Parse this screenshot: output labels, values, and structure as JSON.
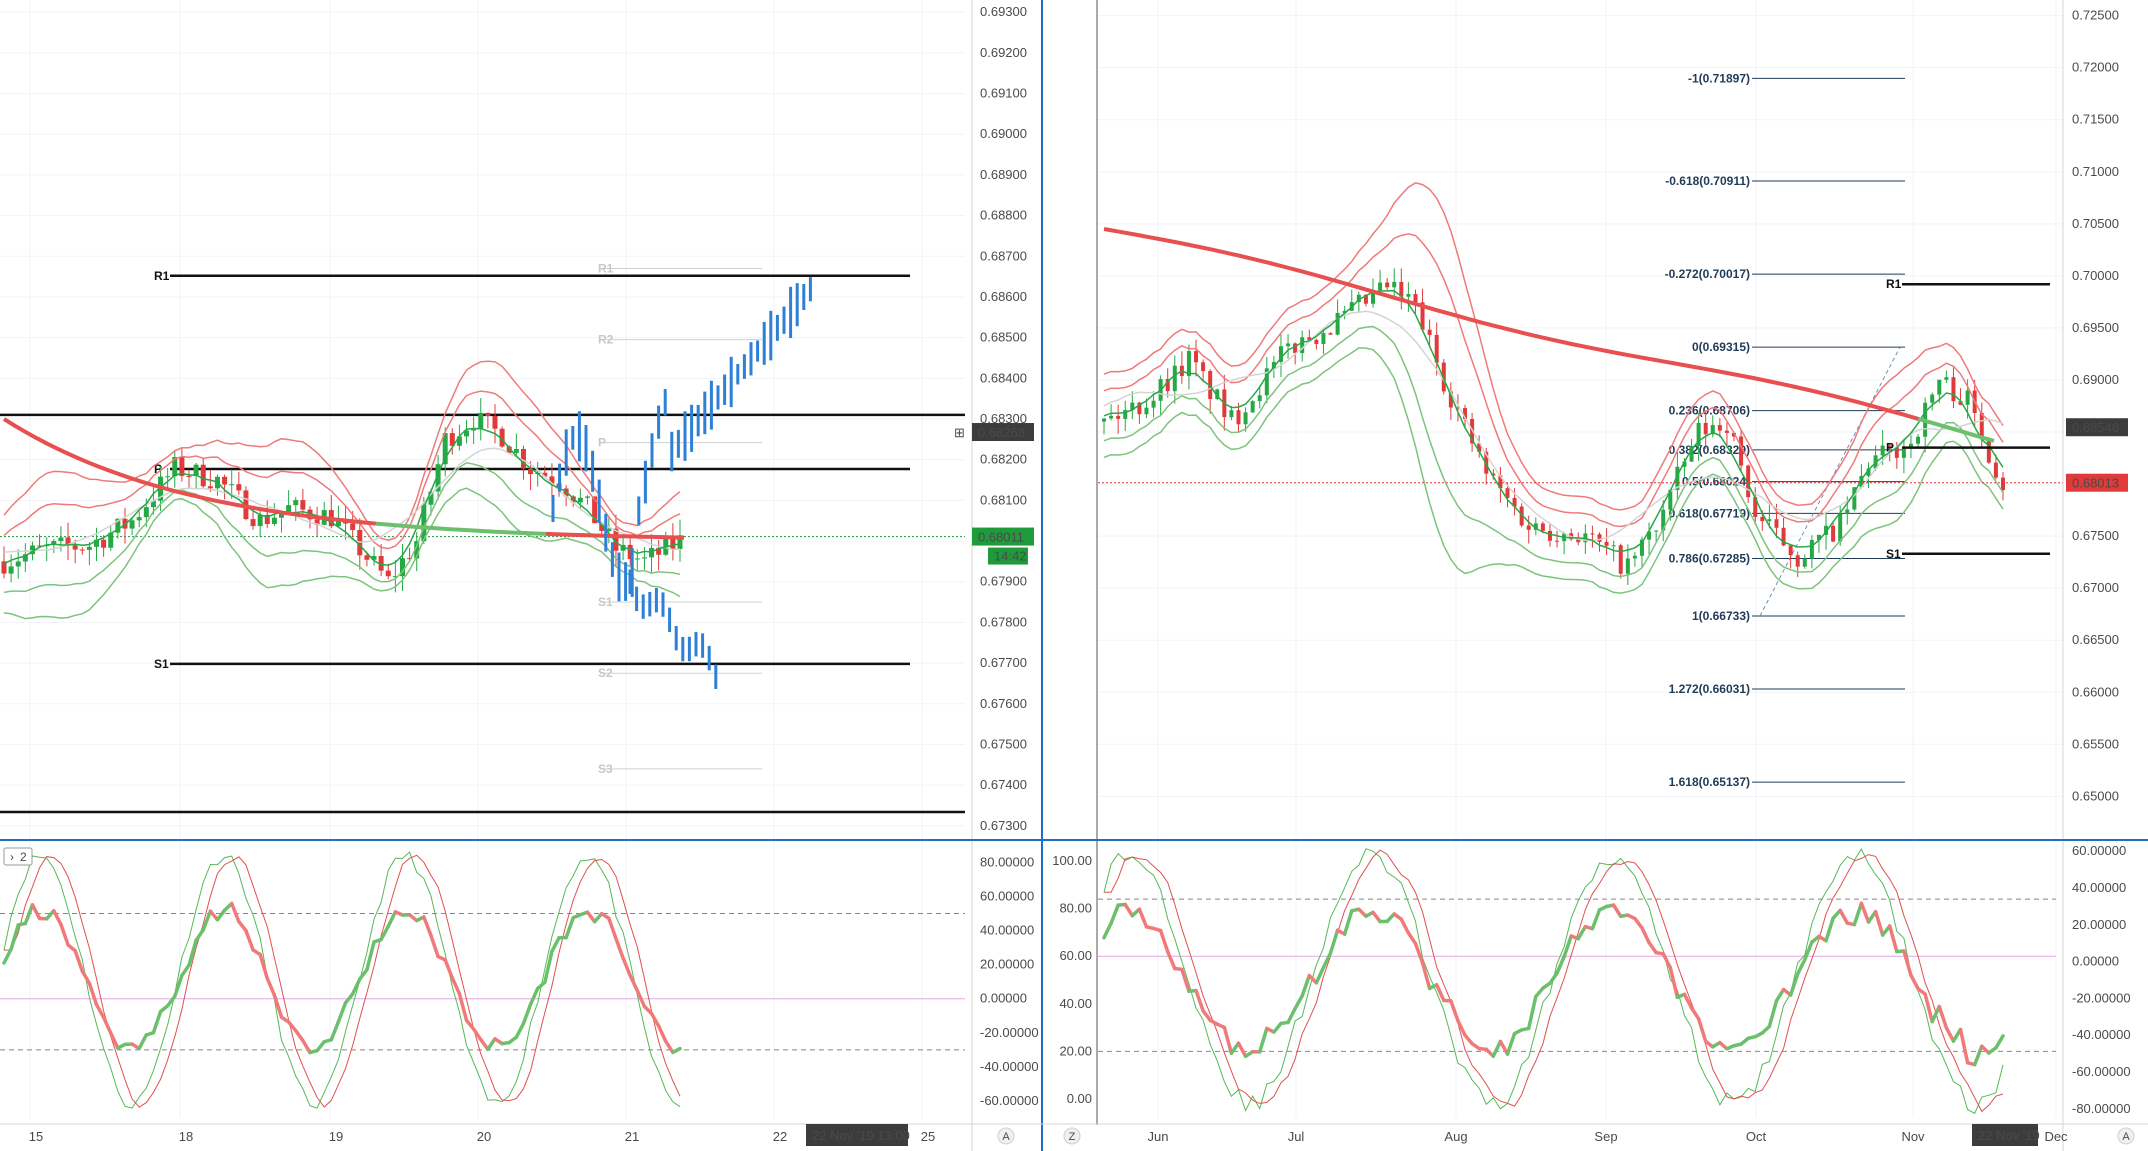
{
  "chart_data": [
    {
      "panel": "left-price",
      "type": "candlestick",
      "y_axis_ticks": [
        "0.69300",
        "0.69200",
        "0.69100",
        "0.69000",
        "0.68900",
        "0.68800",
        "0.68700",
        "0.68600",
        "0.68500",
        "0.68400",
        "0.68300",
        "0.68200",
        "0.68100",
        "0.68000",
        "0.67900",
        "0.67800",
        "0.67700",
        "0.67600",
        "0.67500",
        "0.67400",
        "0.67300"
      ],
      "ylim": [
        0.6727,
        0.6933
      ],
      "x_ticks": [
        "15",
        "18",
        "19",
        "20",
        "21",
        "22",
        "25"
      ],
      "price_badges": {
        "upper": "0.68268",
        "lower": "0.68011",
        "countdown": "14:42"
      },
      "levels": [
        {
          "label": "R1",
          "value": 0.68652
        },
        {
          "label": "P",
          "value": 0.68177
        },
        {
          "label": "S1",
          "value": 0.67698
        },
        {
          "label": "",
          "value": 0.6831
        },
        {
          "label": "",
          "value": 0.67334
        }
      ],
      "ghost_levels": [
        {
          "label": "R1",
          "value": 0.6867
        },
        {
          "label": "R2",
          "value": 0.68495
        },
        {
          "label": "P",
          "value": 0.68242
        },
        {
          "label": "S1",
          "value": 0.6785
        },
        {
          "label": "S2",
          "value": 0.67675
        },
        {
          "label": "S3",
          "value": 0.6744
        }
      ],
      "date_badge": "22 Nov '19  13:00"
    },
    {
      "panel": "right-price",
      "type": "candlestick",
      "y_axis_ticks": [
        "0.72500",
        "0.72000",
        "0.71500",
        "0.71000",
        "0.70500",
        "0.70000",
        "0.69500",
        "0.69000",
        "0.68500",
        "0.68000",
        "0.67500",
        "0.67000",
        "0.66500",
        "0.66000",
        "0.65500",
        "0.65000"
      ],
      "ylim": [
        0.646,
        0.7265
      ],
      "x_ticks": [
        "Jun",
        "Jul",
        "Aug",
        "Sep",
        "Oct",
        "Nov",
        "Dec"
      ],
      "price_badges": {
        "upper": "0.68546",
        "lower": "0.68013"
      },
      "levels": [
        {
          "label": "R1",
          "value": 0.6992
        },
        {
          "label": "P",
          "value": 0.6835
        },
        {
          "label": "S1",
          "value": 0.6733
        }
      ],
      "fibonacci": [
        {
          "label": "-1(0.71897)",
          "value": 0.71897
        },
        {
          "label": "-0.618(0.70911)",
          "value": 0.70911
        },
        {
          "label": "-0.272(0.70017)",
          "value": 0.70017
        },
        {
          "label": "0(0.69315)",
          "value": 0.69315
        },
        {
          "label": "0.236(0.68706)",
          "value": 0.68706
        },
        {
          "label": "0.382(0.68329)",
          "value": 0.68329
        },
        {
          "label": "0.5(0.68024)",
          "value": 0.68024
        },
        {
          "label": "0.618(0.67719)",
          "value": 0.67719
        },
        {
          "label": "0.786(0.67285)",
          "value": 0.67285
        },
        {
          "label": "1(0.66733)",
          "value": 0.66733
        },
        {
          "label": "1.272(0.66031)",
          "value": 0.66031
        },
        {
          "label": "1.618(0.65137)",
          "value": 0.65137
        }
      ],
      "date_badge": "22 Nov '19"
    },
    {
      "panel": "left-oscillator",
      "type": "line",
      "label": "2",
      "y_axis_ticks": [
        "80.00000",
        "60.00000",
        "40.00000",
        "20.00000",
        "0.00000",
        "-20.00000",
        "-40.00000",
        "-60.00000"
      ],
      "ylim": [
        -70,
        92
      ],
      "ref_lines": [
        50,
        0,
        -30
      ]
    },
    {
      "panel": "right-oscillator",
      "type": "line",
      "left_ticks": [
        "100.00",
        "80.00",
        "60.00",
        "40.00",
        "20.00",
        "0.00"
      ],
      "right_ticks": [
        "60.00000",
        "40.00000",
        "20.00000",
        "0.00000",
        "-20.00000",
        "-40.00000",
        "-60.00000",
        "-80.00000"
      ],
      "ref_lines": [
        84,
        60,
        20
      ]
    }
  ],
  "toolbar": {
    "left_marker": "A",
    "right_marker": "A",
    "zoom_marker": "Z",
    "pane_toggle": "2"
  },
  "colors": {
    "green": "#26a845",
    "red": "#e03a3a",
    "blue": "#2e7fd6",
    "ma_red": "#e84f4f",
    "ma_green": "#6cbf6c",
    "axis": "#1f6ec8"
  }
}
